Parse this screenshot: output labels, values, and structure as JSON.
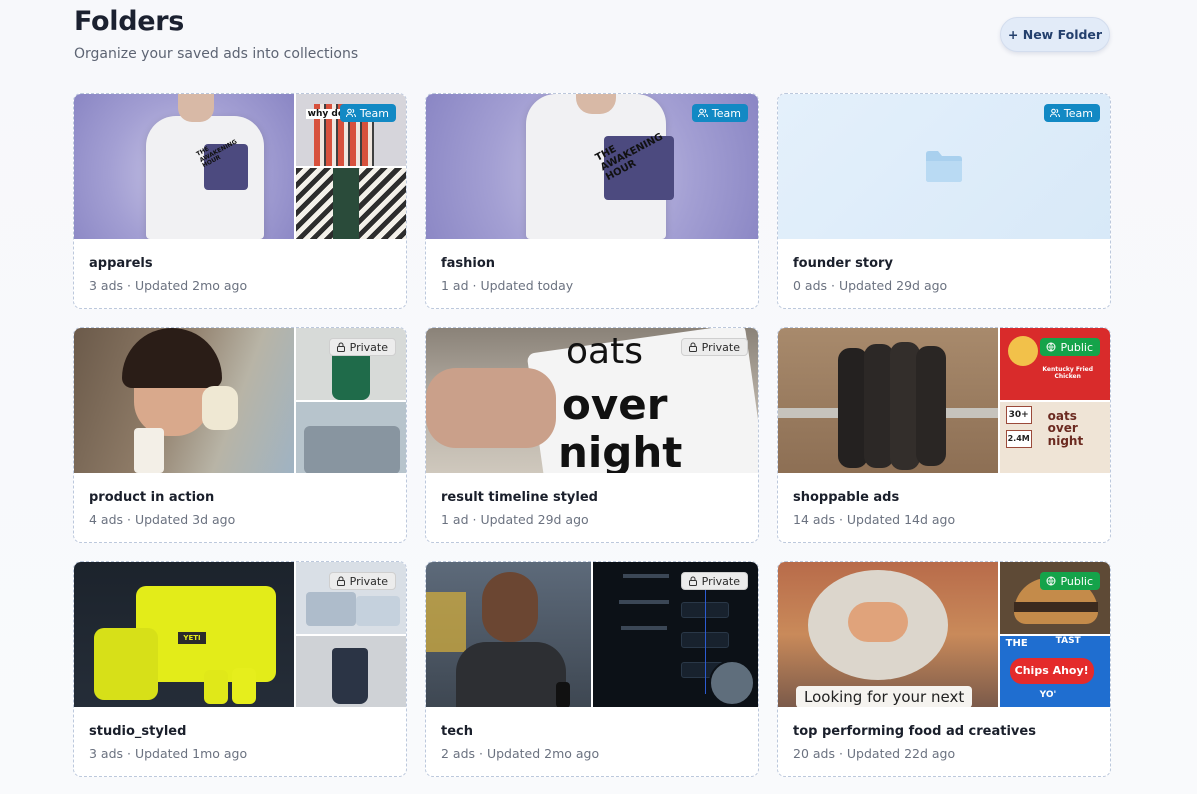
{
  "header": {
    "title": "Folders",
    "subtitle": "Organize your saved ads into collections",
    "new_folder_label": "+ New Folder"
  },
  "folders": [
    {
      "name": "apparels",
      "meta": "3 ads · Updated 2mo ago",
      "badge": "Team"
    },
    {
      "name": "fashion",
      "meta": "1 ad · Updated today",
      "badge": "Team"
    },
    {
      "name": "founder story",
      "meta": "0 ads · Updated 29d ago",
      "badge": "Team"
    },
    {
      "name": "product in action",
      "meta": "4 ads · Updated 3d ago",
      "badge": "Private"
    },
    {
      "name": "result timeline styled",
      "meta": "1 ad · Updated 29d ago",
      "badge": "Private"
    },
    {
      "name": "shoppable ads",
      "meta": "14 ads · Updated 14d ago",
      "badge": "Public"
    },
    {
      "name": "studio_styled",
      "meta": "3 ads · Updated 1mo ago",
      "badge": "Private"
    },
    {
      "name": "tech",
      "meta": "2 ads · Updated 2mo ago",
      "badge": "Private"
    },
    {
      "name": "top performing food ad creatives",
      "meta": "20 ads · Updated 22d ago",
      "badge": "Public"
    }
  ],
  "thumb_text": {
    "tshirt_print": "THE AWAKENING HOUR",
    "apparel_side": "why do",
    "oats_line1": "oats",
    "oats_line2": "over",
    "oats_line3": "night",
    "kfc": "Kentucky Fried Chicken",
    "oats_small": "oats over night",
    "stat1": "30+",
    "stat2": "2.4M",
    "yeti": "YETI",
    "food_caption": "Looking for your next",
    "chips_ahoy_top": "THE",
    "chips_ahoy_top2": "TAST",
    "chips_ahoy": "Chips Ahoy!",
    "chips_ahoy_bottom": "YO'"
  },
  "colors": {
    "team": "#1289c4",
    "private": "#ececec",
    "public": "#15a34a",
    "accent": "#24406d"
  }
}
